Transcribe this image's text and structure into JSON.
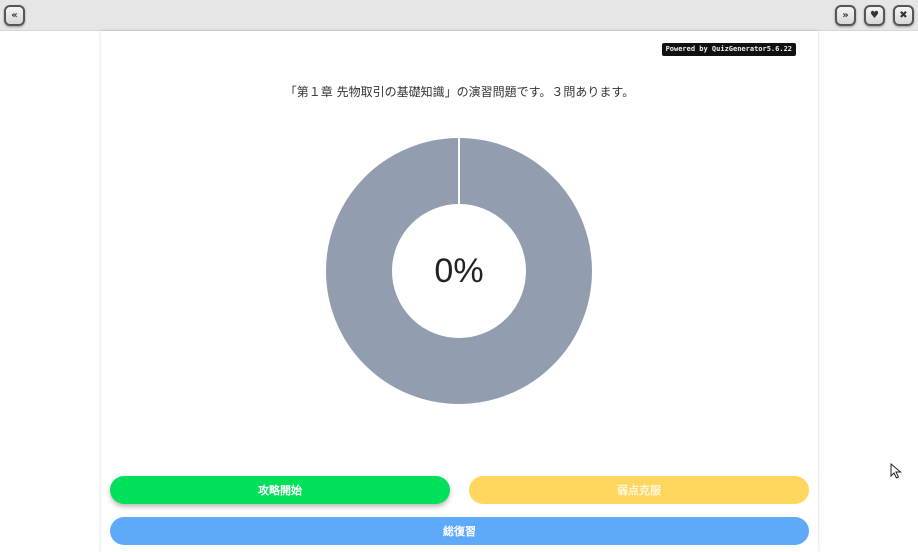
{
  "toolbar": {
    "collapse_icon": "«",
    "next_icon": "»",
    "favorite_icon": "♥",
    "close_icon": "✖"
  },
  "quiz": {
    "powered_by": "Powered by QuizGenerator5.6.22",
    "intro_text": "「第１章 先物取引の基礎知識」の演習問題です。３問あります。",
    "progress_label": "0%",
    "progress_value": 0,
    "donut_color": "#929eb0"
  },
  "actions": {
    "start_label": "攻略開始",
    "weak_label": "弱点克服",
    "review_label": "総復習"
  },
  "colors": {
    "start": "#00e05a",
    "weak": "#ffd75e",
    "review": "#5eaaf8"
  }
}
